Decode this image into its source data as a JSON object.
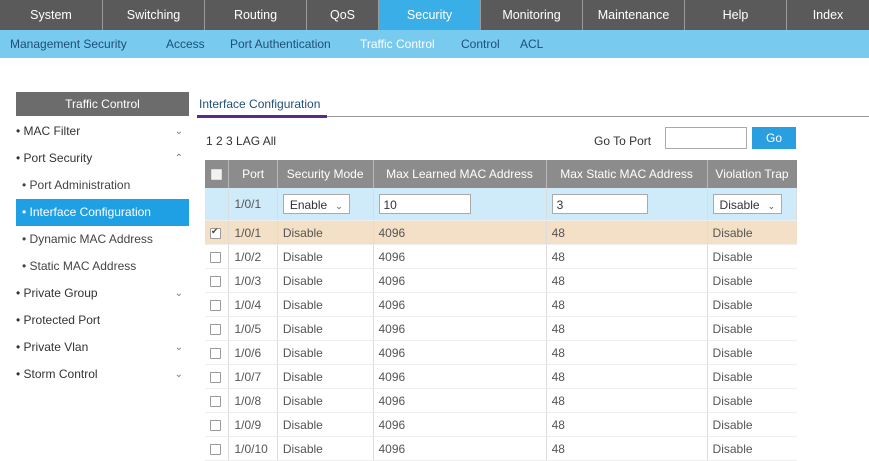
{
  "topnav": [
    {
      "label": "System",
      "active": false
    },
    {
      "label": "Switching",
      "active": false
    },
    {
      "label": "Routing",
      "active": false
    },
    {
      "label": "QoS",
      "active": false
    },
    {
      "label": "Security",
      "active": true
    },
    {
      "label": "Monitoring",
      "active": false
    },
    {
      "label": "Maintenance",
      "active": false
    },
    {
      "label": "Help",
      "active": false
    },
    {
      "label": "Index",
      "active": false
    }
  ],
  "subnav": [
    {
      "label": "Management Security",
      "active": false
    },
    {
      "label": "Access",
      "active": false
    },
    {
      "label": "Port Authentication",
      "active": false
    },
    {
      "label": "Traffic Control",
      "active": true
    },
    {
      "label": "Control",
      "active": false
    },
    {
      "label": "ACL",
      "active": false
    }
  ],
  "sidebar": {
    "title": "Traffic Control",
    "items": [
      {
        "label": "MAC Filter",
        "sub": false,
        "chevron": "down"
      },
      {
        "label": "Port Security",
        "sub": false,
        "chevron": "up"
      },
      {
        "label": "Port Administration",
        "sub": true
      },
      {
        "label": "Interface Configuration",
        "sub": true,
        "active": true
      },
      {
        "label": "Dynamic MAC Address",
        "sub": true
      },
      {
        "label": "Static MAC Address",
        "sub": true
      },
      {
        "label": "Private Group",
        "sub": false,
        "chevron": "down"
      },
      {
        "label": "Protected Port",
        "sub": false
      },
      {
        "label": "Private Vlan",
        "sub": false,
        "chevron": "down"
      },
      {
        "label": "Storm Control",
        "sub": false,
        "chevron": "down"
      }
    ]
  },
  "content": {
    "tab": "Interface Configuration",
    "pages": "1 2 3 LAG All",
    "goto_label": "Go To Port",
    "go_button": "Go"
  },
  "table": {
    "headers": [
      "Port",
      "Security Mode",
      "Max Learned MAC Address",
      "Max Static MAC Address",
      "Violation Trap"
    ],
    "edit_row": {
      "port": "1/0/1",
      "mode": "Enable",
      "learned": "10",
      "static": "3",
      "trap": "Disable"
    },
    "rows": [
      {
        "port": "1/0/1",
        "mode": "Disable",
        "learned": "4096",
        "static": "48",
        "trap": "Disable",
        "checked": true
      },
      {
        "port": "1/0/2",
        "mode": "Disable",
        "learned": "4096",
        "static": "48",
        "trap": "Disable",
        "checked": false
      },
      {
        "port": "1/0/3",
        "mode": "Disable",
        "learned": "4096",
        "static": "48",
        "trap": "Disable",
        "checked": false
      },
      {
        "port": "1/0/4",
        "mode": "Disable",
        "learned": "4096",
        "static": "48",
        "trap": "Disable",
        "checked": false
      },
      {
        "port": "1/0/5",
        "mode": "Disable",
        "learned": "4096",
        "static": "48",
        "trap": "Disable",
        "checked": false
      },
      {
        "port": "1/0/6",
        "mode": "Disable",
        "learned": "4096",
        "static": "48",
        "trap": "Disable",
        "checked": false
      },
      {
        "port": "1/0/7",
        "mode": "Disable",
        "learned": "4096",
        "static": "48",
        "trap": "Disable",
        "checked": false
      },
      {
        "port": "1/0/8",
        "mode": "Disable",
        "learned": "4096",
        "static": "48",
        "trap": "Disable",
        "checked": false
      },
      {
        "port": "1/0/9",
        "mode": "Disable",
        "learned": "4096",
        "static": "48",
        "trap": "Disable",
        "checked": false
      },
      {
        "port": "1/0/10",
        "mode": "Disable",
        "learned": "4096",
        "static": "48",
        "trap": "Disable",
        "checked": false
      }
    ]
  },
  "colors": {
    "nav_bg": "#5a5a5a",
    "nav_active": "#3aaee6",
    "subnav_bg": "#78caef",
    "side_active": "#1f9fe4",
    "selected_row": "#f3e0c6"
  }
}
